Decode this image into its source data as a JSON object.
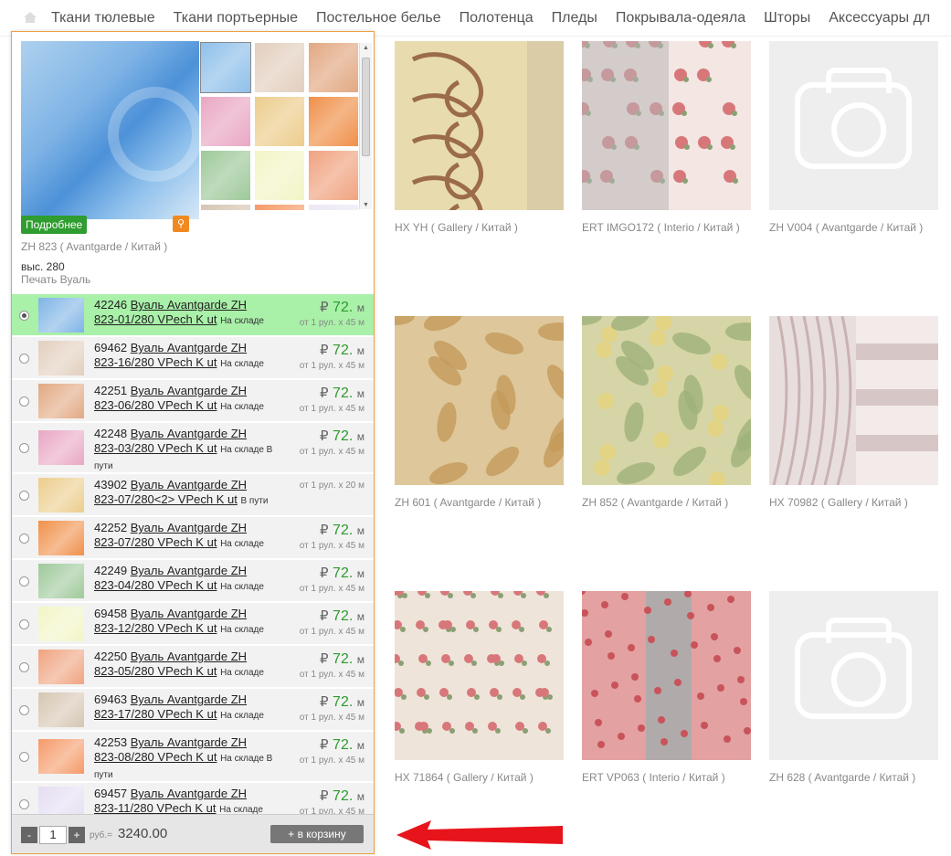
{
  "nav": {
    "items": [
      "Ткани тюлевые",
      "Ткани портьерные",
      "Постельное белье",
      "Полотенца",
      "Пледы",
      "Покрывала-одеяла",
      "Шторы",
      "Аксессуары дл"
    ]
  },
  "grid": {
    "cards": [
      {
        "caption": "HX YH ( Gallery / Китай )",
        "style": "swirl",
        "color": "#e6d7a6"
      },
      {
        "caption": "ERT IMGO172 ( Interio / Китай )",
        "style": "roses",
        "color": "#f3e6e3"
      },
      {
        "caption": "ZH V004 ( Avantgarde / Китай )",
        "style": "placeholder",
        "color": "#eeeeee"
      },
      {
        "caption": "ZH 601 ( Avantgarde / Китай )",
        "style": "floral",
        "color": "#ddc79b"
      },
      {
        "caption": "ZH 852 ( Avantgarde / Китай )",
        "style": "leaves",
        "color": "#d6d5a8"
      },
      {
        "caption": "HX 70982 ( Gallery / Китай )",
        "style": "drape",
        "color": "#e9dede"
      },
      {
        "caption": "HX 71864 ( Gallery / Китай )",
        "style": "smallroses",
        "color": "#efe4d9"
      },
      {
        "caption": "ERT VP063 ( Interio / Китай )",
        "style": "pinkdrape",
        "color": "#e3a1a1"
      },
      {
        "caption": "ZH 628 ( Avantgarde / Китай )",
        "style": "placeholder",
        "color": "#eeeeee"
      }
    ]
  },
  "panel": {
    "more_label": "Подробнее",
    "pin_icon": "pin-icon",
    "model": "ZH 823 ( Avantgarde / Китай )",
    "height": "выс. 280",
    "type": "Печать Вуаль",
    "thumb_colors": [
      "#8fc0ea",
      "#e2cfbe",
      "#e2a882",
      "#e9a7c4",
      "#eccd8c",
      "#f0904a",
      "#9ec99a",
      "#f2f5c6",
      "#f0a380",
      "#d6c6b2",
      "#f59a68",
      "#ece7f4"
    ],
    "variants": [
      {
        "code": "42246",
        "name1": "Вуаль Avantgarde ZH",
        "name2": "823-01/280 VPech K ut",
        "status": "На складе",
        "currency": "₽",
        "price": "72.",
        "unit": "м",
        "sub": "от 1 рул. х 45 м",
        "color": "#7fb4e6",
        "active": true
      },
      {
        "code": "69462",
        "name1": "Вуаль Avantgarde ZH",
        "name2": "823-16/280 VPech K ut",
        "status": "На складе",
        "currency": "₽",
        "price": "72.",
        "unit": "м",
        "sub": "от 1 рул. х 45 м",
        "color": "#e2cfbe",
        "active": false
      },
      {
        "code": "42251",
        "name1": "Вуаль Avantgarde ZH",
        "name2": "823-06/280 VPech K ut",
        "status": "На складе",
        "currency": "₽",
        "price": "72.",
        "unit": "м",
        "sub": "от 1 рул. х 45 м",
        "color": "#e2a882",
        "active": false
      },
      {
        "code": "42248",
        "name1": "Вуаль Avantgarde ZH",
        "name2": "823-03/280 VPech K ut",
        "status": "На складе В пути",
        "currency": "₽",
        "price": "72.",
        "unit": "м",
        "sub": "от 1 рул. х 45 м",
        "color": "#e9a7c4",
        "active": false
      },
      {
        "code": "43902",
        "name1": "Вуаль Avantgarde ZH",
        "name2": "823-07/280<2> VPech K ut",
        "status": "В пути",
        "currency": "",
        "price": "",
        "unit": "",
        "sub": "от 1 рул. х 20 м",
        "color": "#eccd8c",
        "active": false
      },
      {
        "code": "42252",
        "name1": "Вуаль Avantgarde ZH",
        "name2": "823-07/280 VPech K ut",
        "status": "На складе",
        "currency": "₽",
        "price": "72.",
        "unit": "м",
        "sub": "от 1 рул. х 45 м",
        "color": "#f0904a",
        "active": false
      },
      {
        "code": "42249",
        "name1": "Вуаль Avantgarde ZH",
        "name2": "823-04/280 VPech K ut",
        "status": "На складе",
        "currency": "₽",
        "price": "72.",
        "unit": "м",
        "sub": "от 1 рул. х 45 м",
        "color": "#9ec99a",
        "active": false
      },
      {
        "code": "69458",
        "name1": "Вуаль Avantgarde ZH",
        "name2": "823-12/280 VPech K ut",
        "status": "На складе",
        "currency": "₽",
        "price": "72.",
        "unit": "м",
        "sub": "от 1 рул. х 45 м",
        "color": "#f2f5c6",
        "active": false
      },
      {
        "code": "42250",
        "name1": "Вуаль Avantgarde ZH",
        "name2": "823-05/280 VPech K ut",
        "status": "На складе",
        "currency": "₽",
        "price": "72.",
        "unit": "м",
        "sub": "от 1 рул. х 45 м",
        "color": "#f0a380",
        "active": false
      },
      {
        "code": "69463",
        "name1": "Вуаль Avantgarde ZH",
        "name2": "823-17/280 VPech K ut",
        "status": "На складе",
        "currency": "₽",
        "price": "72.",
        "unit": "м",
        "sub": "от 1 рул. х 45 м",
        "color": "#d6c6b2",
        "active": false
      },
      {
        "code": "42253",
        "name1": "Вуаль Avantgarde ZH",
        "name2": "823-08/280 VPech K ut",
        "status": "На складе В пути",
        "currency": "₽",
        "price": "72.",
        "unit": "м",
        "sub": "от 1 рул. х 45 м",
        "color": "#f59a68",
        "active": false
      },
      {
        "code": "69457",
        "name1": "Вуаль Avantgarde ZH",
        "name2": "823-11/280 VPech K ut",
        "status": "На складе",
        "currency": "₽",
        "price": "72.",
        "unit": "м",
        "sub": "от 1 рул. х 45 м",
        "color": "#e5def2",
        "active": false
      }
    ],
    "footer": {
      "minus": "-",
      "qty": "1",
      "plus": "+",
      "currency": "руб.=",
      "total": "3240.00",
      "cart_label": "+ в корзину"
    }
  },
  "annotation": {
    "arrow_color": "#e8141c"
  }
}
